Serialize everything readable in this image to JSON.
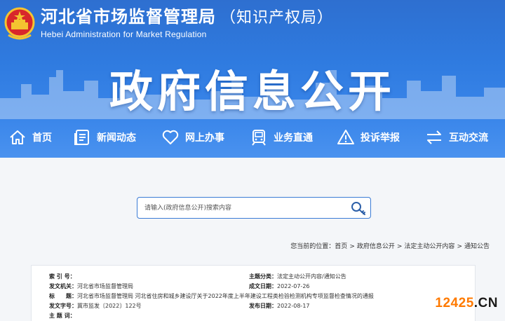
{
  "header": {
    "agency_cn": "河北省市场监督管理局",
    "agency_cn_suffix": "（知识产权局）",
    "agency_en": "Hebei Administration for Market Regulation",
    "banner_title": "政府信息公开"
  },
  "nav": {
    "items": [
      {
        "label": "首页",
        "icon": "home-icon"
      },
      {
        "label": "新闻动态",
        "icon": "news-icon"
      },
      {
        "label": "网上办事",
        "icon": "heart-hand-icon"
      },
      {
        "label": "业务直通",
        "icon": "train-icon"
      },
      {
        "label": "投诉举报",
        "icon": "warning-icon"
      },
      {
        "label": "互动交流",
        "icon": "exchange-icon"
      }
    ]
  },
  "search": {
    "placeholder": "请输入(政府信息公开)搜索内容"
  },
  "breadcrumb": {
    "prefix": "您当前的位置：",
    "items": [
      "首页",
      "政府信息公开",
      "法定主动公开内容",
      "通知公告"
    ],
    "separator": ">"
  },
  "info": {
    "index_label": "索 引 号：",
    "index_value": "",
    "issuer_label": "发文机关：",
    "issuer_value": "河北省市场监督管理局",
    "title_label": "标　　题：",
    "title_value": "河北省市场监督管理局 河北省住房和城乡建设厅关于2022年度上半年建设工程类检验检测机构专项监督检查情况的通报",
    "doc_no_label": "发文字号：",
    "doc_no_value": "冀市监发〔2022〕122号",
    "keywords_label": "主 题 词：",
    "keywords_value": "",
    "category_label": "主题分类：",
    "category_value": "法定主动公开内容/通知公告",
    "created_label": "成文日期：",
    "created_value": "2022-07-26",
    "published_label": "发布日期：",
    "published_value": "2022-08-17"
  },
  "watermark": {
    "number": "12425",
    "suffix": ".CN"
  },
  "colors": {
    "header_blue": "#2f7be0",
    "search_border": "#3a7bd5",
    "watermark_orange": "#ff7a00"
  }
}
